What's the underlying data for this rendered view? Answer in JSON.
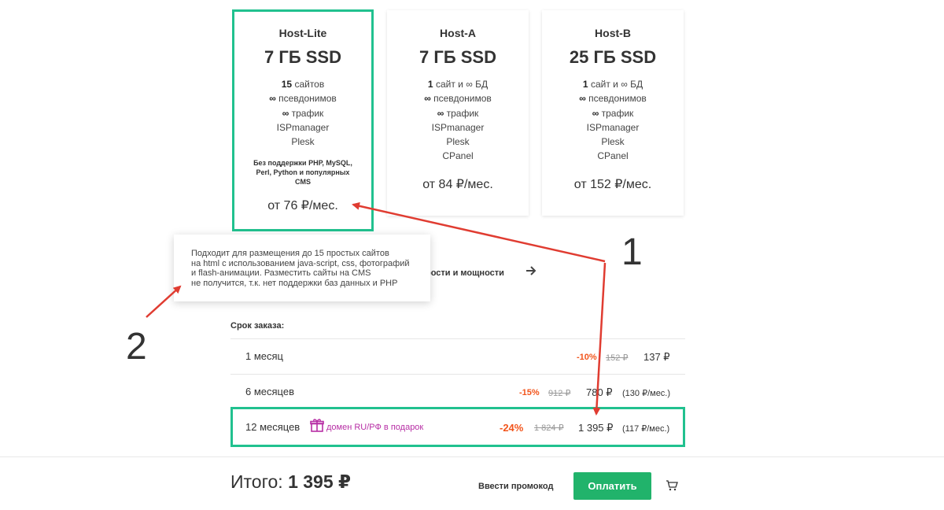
{
  "plans": [
    {
      "name": "Host-Lite",
      "disk": "7 ГБ SSD",
      "sites_num": "15",
      "sites_text": " сайтов",
      "aliases": "псевдонимов",
      "traffic": "трафик",
      "panels": [
        "ISPmanager",
        "Plesk"
      ],
      "note": "Без поддержки PHP, MySQL, Perl, Python и популярных CMS",
      "price": "от 76 ₽/мес."
    },
    {
      "name": "Host-A",
      "disk": "7 ГБ SSD",
      "sites_num": "1",
      "sites_text": " сайт и ∞ БД",
      "aliases": "псевдонимов",
      "traffic": "трафик",
      "panels": [
        "ISPmanager",
        "Plesk",
        "CPanel"
      ],
      "price": "от 84 ₽/мес."
    },
    {
      "name": "Host-B",
      "disk": "25 ГБ SSD",
      "sites_num": "1",
      "sites_text": " сайт и ∞ БД",
      "aliases": "псевдонимов",
      "traffic": "трафик",
      "panels": [
        "ISPmanager",
        "Plesk",
        "CPanel"
      ],
      "price": "от 152 ₽/мес."
    }
  ],
  "infinity_symbol": "∞",
  "tooltip": {
    "lines": [
      "Подходит для размещения до 15 простых сайтов",
      "на html с использованием java-script, css, фотографий",
      "и flash-анимации. Разместить сайты на CMS",
      "не получится, т.к. нет поддержки баз данных и PHP"
    ]
  },
  "compare_link": "рости и мощности",
  "order": {
    "title": "Срок заказа:",
    "rows": [
      {
        "label": "1 месяц",
        "discount": "-10%",
        "old_price": "152 ₽",
        "new_price": "137 ₽",
        "per_month": ""
      },
      {
        "label": "6 месяцев",
        "discount": "-15%",
        "old_price": "912 ₽",
        "new_price": "780 ₽",
        "per_month": "(130 ₽/мес.)"
      },
      {
        "label": "12 месяцев",
        "gift": "домен RU/РФ в подарок",
        "discount": "-24%",
        "old_price": "1 824 ₽",
        "new_price": "1 395 ₽",
        "per_month": "(117 ₽/мес.)"
      }
    ]
  },
  "footer": {
    "total_label": "Итого:",
    "total_value": "1 395 ₽",
    "promo": "Ввести промокод",
    "pay": "Оплатить"
  },
  "annotations": [
    "1",
    "2"
  ],
  "colors": {
    "accent": "#21c18f",
    "pay_button": "#21b36b",
    "discount": "#f2541b",
    "gift": "#b72fa5",
    "arrow": "#e03c31"
  },
  "icons": [
    "gift-icon",
    "cart-icon",
    "arrow-right-icon"
  ]
}
